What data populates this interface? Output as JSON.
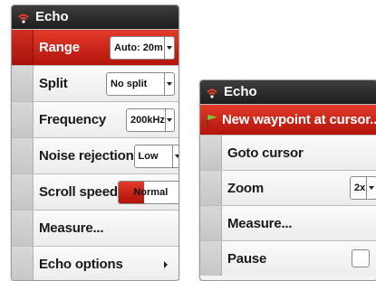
{
  "left_menu": {
    "title": "Echo",
    "items": [
      {
        "label": "Range",
        "value": "Auto: 20m"
      },
      {
        "label": "Split",
        "value": "No split"
      },
      {
        "label": "Frequency",
        "value": "200kHz"
      },
      {
        "label": "Noise rejection",
        "value": "Low"
      },
      {
        "label": "Scroll speed",
        "value": "Normal",
        "level_fraction": 0.4
      },
      {
        "label": "Measure..."
      },
      {
        "label": "Echo options"
      }
    ]
  },
  "right_menu": {
    "title": "Echo",
    "items": [
      {
        "label": "New waypoint at cursor..."
      },
      {
        "label": "Goto cursor"
      },
      {
        "label": "Zoom",
        "value": "2x"
      },
      {
        "label": "Measure..."
      },
      {
        "label": "Pause"
      }
    ]
  },
  "icons": {
    "title_icon": "echo-sonar-icon",
    "waypoint_icon": "waypoint-flag-icon",
    "dropdown": "chevron-down-icon",
    "submenu": "chevron-right-icon"
  },
  "colors": {
    "selected_row": "#d0281a",
    "title_bar": "#2a2a2a",
    "sonar_icon": "#e8402c",
    "flag": "#7fc23a"
  }
}
